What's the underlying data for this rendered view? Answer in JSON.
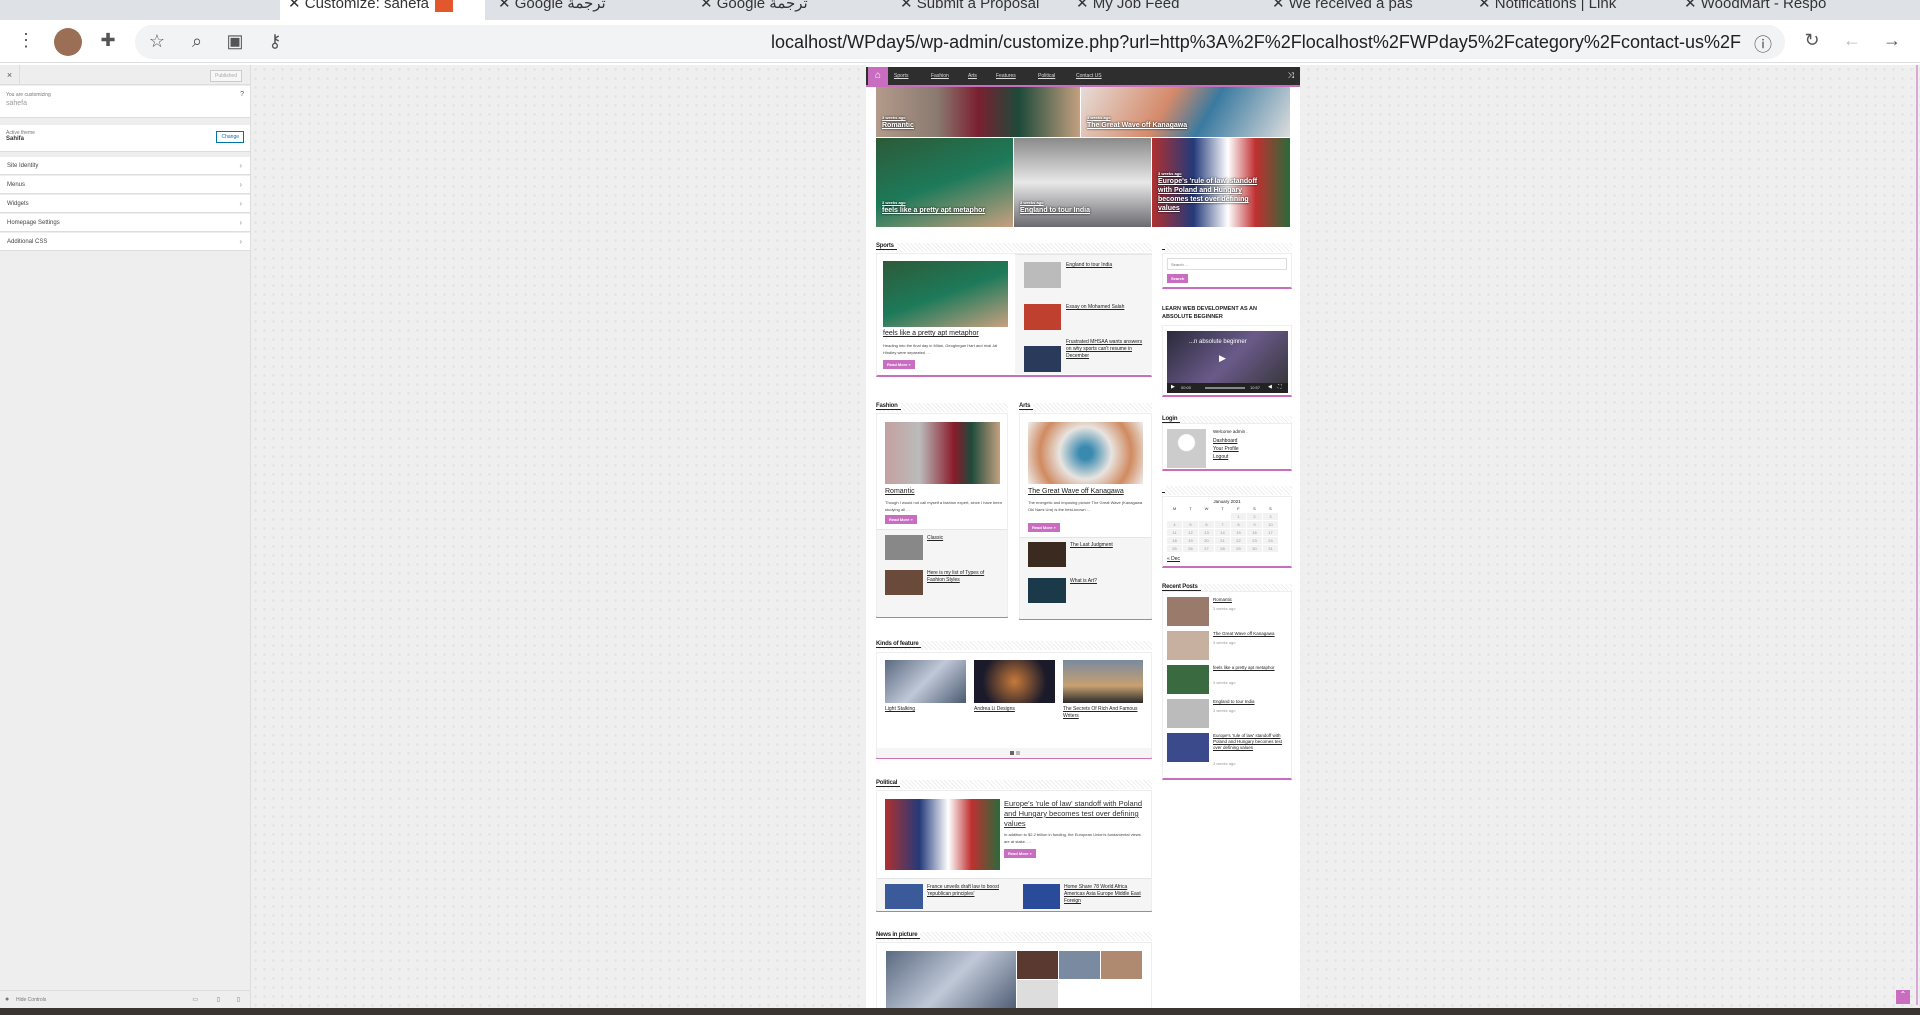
{
  "browser": {
    "tabs": [
      {
        "label": "Customize: sahefa",
        "active": true
      },
      {
        "label": "Google ترجمة"
      },
      {
        "label": "Google ترجمة"
      },
      {
        "label": "Submit a Proposal"
      },
      {
        "label": "My Job Feed"
      },
      {
        "label": "We received a pas"
      },
      {
        "label": "Notifications | Link"
      },
      {
        "label": "WoodMart - Respo"
      }
    ],
    "url": "localhost/WPday5/wp-admin/customize.php?url=http%3A%2F%2Flocalhost%2FWPday5%2Fcategory%2Fcontact-us%2F",
    "icons": [
      "menu-icon",
      "avatar",
      "extensions-icon",
      "star-icon",
      "zoom-icon",
      "translate-icon",
      "key-icon",
      "info-icon",
      "reload-icon",
      "back-icon",
      "forward-icon"
    ]
  },
  "customizer": {
    "close": "×",
    "published": "Published",
    "customizing_label": "You are customizing",
    "site_name": "sahefa",
    "active_theme_label": "Active theme",
    "theme_name": "Sahifa",
    "change": "Change",
    "sections": [
      "Site Identity",
      "Menus",
      "Widgets",
      "Homepage Settings",
      "Additional CSS"
    ],
    "hide_controls": "Hide Controls"
  },
  "site": {
    "accent": "#c86dc0",
    "nav": [
      "Sports",
      "Fashion",
      "Arts",
      "Features",
      "Political",
      "Contact US"
    ],
    "slider": [
      {
        "title": "Romantic",
        "ago": "3 weeks ago"
      },
      {
        "title": "The Great Wave off Kanagawa",
        "ago": "3 weeks ago"
      },
      {
        "title": "feels like a pretty apt metaphor",
        "ago": "3 weeks ago"
      },
      {
        "title": "England to tour India",
        "ago": "3 weeks ago"
      },
      {
        "title": "Europe's 'rule of law' standoff with Poland and Hungary becomes test over defining values",
        "ago": "3 weeks ago"
      }
    ],
    "read_more": "Read More »",
    "sports": {
      "heading": "Sports",
      "main_title": "feels like a pretty apt metaphor",
      "excerpt": "Heading into the final day in Milan, Geoghegan Hart and rival Jai Hindley were separated …",
      "list": [
        "England to tour India",
        "Essay on Mohamed Salah",
        "Frustrated MHSAA wants answers on why sports can't resume in December"
      ]
    },
    "fashion": {
      "heading": "Fashion",
      "main_title": "Romantic",
      "excerpt": "Though I would not call myself a fashion expert, since I have been studying all …",
      "list": [
        "Classic",
        "Here is my list of Types of Fashion Styles"
      ]
    },
    "arts": {
      "heading": "Arts",
      "main_title": "The Great Wave off Kanagawa",
      "excerpt": "The energetic and imposing picture The Great Wave (Kanagawa Oki Nami Ura) is the best-known …",
      "list": [
        "The Last Judgment",
        "What is Art?"
      ]
    },
    "features": {
      "heading": "Kinds of feature",
      "items": [
        "Light Stalking",
        "Andrea Li Designs",
        "The Secrets Of Rich And Famous Writers"
      ]
    },
    "political": {
      "heading": "Political",
      "main_title": "Europe's 'rule of law' standoff with Poland and Hungary becomes test over defining values",
      "excerpt": "In addition to $2.2 trillion in funding, the European Union's fundamental views are at stake. …",
      "list": [
        "France unveils draft law to boost 'republican principles'",
        "Home Share 78 World Africa Americas Asia Europe Middle East Foreign"
      ]
    },
    "news_in_picture": {
      "heading": "News in picture"
    },
    "sidebar": {
      "search_placeholder": "Search ...",
      "search_button": "Search",
      "video_heading": "Learn Web Development as an absolute beginner",
      "video_title": "...n absolute beginner",
      "video_time": "00:00",
      "video_duration": "10:57",
      "login_heading": "Login",
      "welcome": "Welcome admin .",
      "login_links": [
        "Dashboard",
        "Your Profile",
        "Logout"
      ],
      "calendar_title": "January 2021",
      "weekdays": [
        "M",
        "T",
        "W",
        "T",
        "F",
        "S",
        "S"
      ],
      "weeks": [
        [
          "",
          "",
          "",
          "",
          "1",
          "2",
          "3"
        ],
        [
          "4",
          "5",
          "6",
          "7",
          "8",
          "9",
          "10"
        ],
        [
          "11",
          "12",
          "13",
          "14",
          "15",
          "16",
          "17"
        ],
        [
          "18",
          "19",
          "20",
          "21",
          "22",
          "23",
          "24"
        ],
        [
          "25",
          "26",
          "27",
          "28",
          "29",
          "30",
          "31"
        ]
      ],
      "calendar_prev": "« Dec",
      "recent_heading": "Recent Posts",
      "recent": [
        {
          "title": "Romantic",
          "ago": "3 weeks ago"
        },
        {
          "title": "The Great Wave off Kanagawa",
          "ago": "3 weeks ago"
        },
        {
          "title": "feels like a pretty apt metaphor",
          "ago": "3 weeks ago"
        },
        {
          "title": "England to tour India",
          "ago": "3 weeks ago"
        },
        {
          "title": "Europe's 'rule of law' standoff with Poland and Hungary becomes test over defining values",
          "ago": "3 weeks ago"
        }
      ]
    }
  }
}
